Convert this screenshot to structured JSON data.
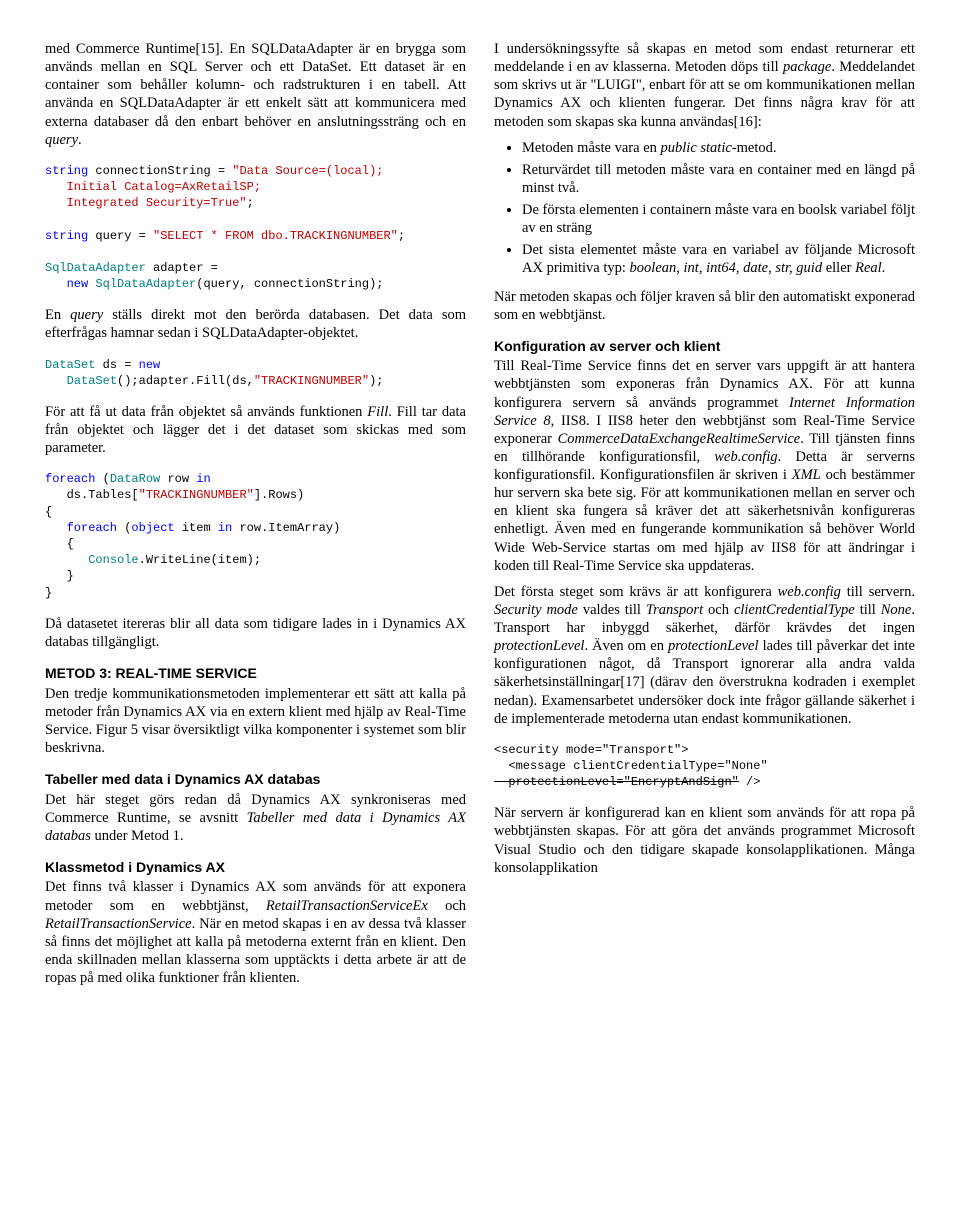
{
  "left": {
    "p1_a": "med Commerce Runtime[15]. En SQLDataAdapter är en brygga som används mellan en SQL Server och ett DataSet. Ett dataset är en container som behåller kolumn- och radstrukturen i en tabell. Att använda en SQLDataAdapter är ett enkelt sätt att kommunicera med externa databaser då den enbart behöver en anslutningssträng och en ",
    "p1_b": "query",
    "p1_c": ".",
    "code1": {
      "l1a": "string",
      "l1b": " connectionString = ",
      "l1c": "\"Data Source=(local);",
      "l2": "   Initial Catalog=AxRetailSP;",
      "l3": "   Integrated Security=True\"",
      "l3b": ";",
      "l4a": "string",
      "l4b": " query = ",
      "l4c": "\"SELECT * FROM dbo.TRACKINGNUMBER\"",
      "l4d": ";",
      "l5a": "SqlDataAdapter",
      "l5b": " adapter =",
      "l6a": "   new ",
      "l6b": "SqlDataAdapter",
      "l6c": "(query, connectionString);"
    },
    "p2_a": "En ",
    "p2_b": "query",
    "p2_c": " ställs direkt mot den berörda databasen. Det data som efterfrågas hamnar sedan i SQLDataAdapter-objektet.",
    "code2": {
      "l1a": "DataSet",
      "l1b": " ds = ",
      "l1c": "new",
      "l2a": "   ",
      "l2b": "DataSet",
      "l2c": "();adapter.Fill(ds,",
      "l2d": "\"TRACKINGNUMBER\"",
      "l2e": ");"
    },
    "p3_a": "För att få ut data från objektet så används funktionen ",
    "p3_b": "Fill",
    "p3_c": ". Fill tar data från objektet och lägger det i det dataset som skickas med som parameter.",
    "code3": {
      "l1a": "foreach",
      "l1b": " (",
      "l1c": "DataRow",
      "l1d": " row ",
      "l1e": "in",
      "l2a": "   ds.Tables[",
      "l2b": "\"TRACKINGNUMBER\"",
      "l2c": "].Rows)",
      "l3": "{",
      "l4a": "   foreach",
      "l4b": " (",
      "l4c": "object",
      "l4d": " item ",
      "l4e": "in",
      "l4f": " row.ItemArray)",
      "l5": "   {",
      "l6a": "      ",
      "l6b": "Console",
      "l6c": ".WriteLine(item);",
      "l7": "   }",
      "l8": "}"
    },
    "p4": "Då datasetet itereras blir all data som tidigare lades in i Dynamics AX databas tillgängligt.",
    "h1": "METOD 3: REAL-TIME SERVICE",
    "p5": "Den tredje kommunikationsmetoden implementerar ett sätt att kalla på metoder från Dynamics AX via en extern klient med hjälp av Real-Time Service. Figur 5 visar översiktligt vilka komponenter i systemet som blir beskrivna.",
    "h2": "Tabeller med data i Dynamics AX databas",
    "p6_a": "Det här steget görs redan då Dynamics AX synkroniseras med Commerce Runtime, se avsnitt ",
    "p6_b": "Tabeller med data i Dynamics AX databas",
    "p6_c": " under Metod 1.",
    "h3": "Klassmetod i Dynamics AX",
    "p7_a": "Det finns två klasser i Dynamics AX som används för att exponera metoder som en webbtjänst, ",
    "p7_b": "RetailTransactionServiceEx",
    "p7_c": " och ",
    "p7_d": "RetailTransactionService",
    "p7_e": ". När en metod skapas i en av dessa två klasser så finns det möjlighet att kalla på metoderna externt från en klient. Den enda skillnaden mellan klasserna som upptäckts i detta arbete är att de ropas på med olika funktioner från klienten."
  },
  "right": {
    "p1_a": "I undersökningssyfte så skapas en metod som endast returnerar ett meddelande i en av klasserna. Metoden döps till ",
    "p1_b": "package",
    "p1_c": ". Meddelandet som skrivs ut är \"LUIGI\", enbart för att se om kommunikationen mellan Dynamics AX och klienten fungerar. Det finns några krav för att metoden som skapas ska kunna användas[16]:",
    "b1_a": "Metoden måste vara en ",
    "b1_b": "public static",
    "b1_c": "-metod.",
    "b2": "Returvärdet till metoden måste vara  en container med en längd på minst två.",
    "b3": "De första elementen i containern måste vara en boolsk variabel följt av en sträng",
    "b4_a": "Det sista elementet måste vara en variabel av följande Microsoft AX primitiva typ: ",
    "b4_b": "boolean, int, int64, date, str, guid",
    "b4_c": " eller ",
    "b4_d": "Real",
    "b4_e": ".",
    "p2": "När metoden skapas och följer kraven så blir den automatiskt exponerad som en webbtjänst.",
    "h1": "Konfiguration av server och klient",
    "p3_a": "Till Real-Time Service finns det en server vars uppgift är att hantera webbtjänsten som exponeras från Dynamics AX. För att kunna konfigurera servern så används programmet ",
    "p3_b": "Internet Information Service 8",
    "p3_c": ", IIS8. I IIS8 heter den webbtjänst som Real-Time Service exponerar ",
    "p3_d": "CommerceDataExchangeRealtimeService",
    "p3_e": ". Till tjänsten finns en tillhörande konfigurationsfil, ",
    "p3_f": "web.config",
    "p3_g": ". Detta är serverns konfigurationsfil. Konfigurationsfilen är skriven i ",
    "p3_h": "XML",
    "p3_i": " och bestämmer hur servern ska bete sig. För att kommunikationen mellan en server och en klient ska fungera så kräver det att säkerhetsnivån konfigureras enhetligt. Även med en fungerande kommunikation så behöver World Wide Web-Service startas om med hjälp av IIS8 för att ändringar i koden till Real-Time Service ska uppdateras.",
    "p4_a": "Det första steget som krävs är att konfigurera ",
    "p4_b": "web.config",
    "p4_c": " till servern. ",
    "p4_d": "Security mode",
    "p4_e": " valdes till ",
    "p4_f": "Transport",
    "p4_g": " och ",
    "p4_h": "clientCredentialType",
    "p4_i": " till ",
    "p4_j": "None",
    "p4_k": ". Transport har inbyggd säkerhet, därför krävdes det ingen ",
    "p4_l": "protectionLevel",
    "p4_m": ". Även om en ",
    "p4_n": "protectionLevel",
    "p4_o": " lades till påverkar det inte konfigurationen något, då Transport ignorerar alla andra valda säkerhetsinställningar[17] (därav den överstrukna kodraden i exemplet nedan).  Examensarbetet undersöker dock inte frågor gällande säkerhet i de implementerade metoderna utan endast kommunikationen.",
    "code4": {
      "l1": "<security mode=\"Transport\">",
      "l2": "  <message clientCredentialType=\"None\"",
      "l3": "  protectionLevel=\"EncryptAndSign\"",
      "l3b": " />"
    },
    "p5": "När servern är konfigurerad kan en klient som används för att ropa på webbtjänsten skapas. För att göra det används programmet Microsoft Visual Studio och den tidigare skapade konsolapplikationen. Många konsolapplikation"
  }
}
